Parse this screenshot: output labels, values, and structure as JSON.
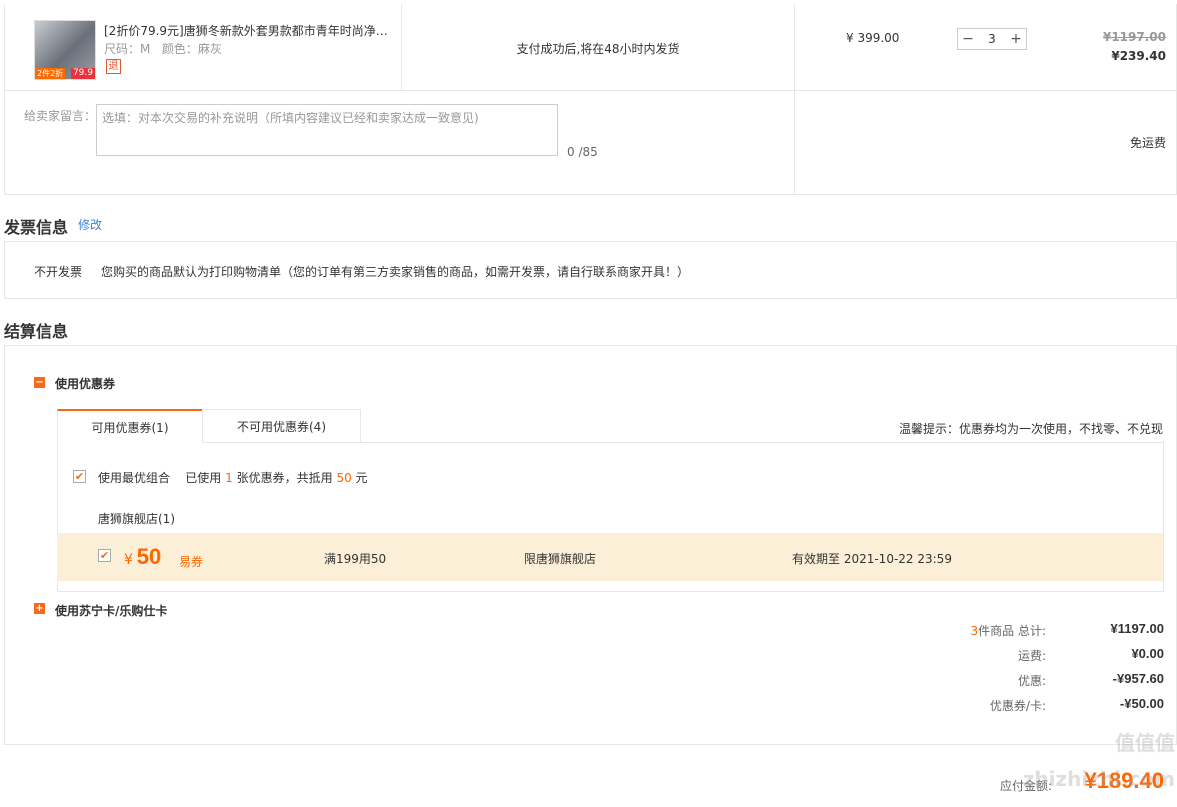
{
  "product": {
    "title": "[2折价79.9元]唐狮冬新款外套男款都市青年时尚净…",
    "size_label": "尺码：",
    "size_value": "M",
    "color_label": "颜色：",
    "color_value": "麻灰",
    "return_badge": "退",
    "thumb_tag": "2件2折",
    "thumb_price": "79.9",
    "shipping_note": "支付成功后,将在48小时内发货",
    "unit_price": "¥ 399.00",
    "quantity": "3",
    "original_total": "¥1197.00",
    "total": "¥239.40"
  },
  "remark": {
    "label": "给卖家留言：",
    "placeholder": "选填：对本次交易的补充说明（所填内容建议已经和卖家达成一致意见)",
    "counter": "0 /85",
    "freight": "免运费"
  },
  "invoice": {
    "title": "发票信息",
    "edit": "修改",
    "type": "不开发票",
    "note": "您购买的商品默认为打印购物清单（您的订单有第三方卖家销售的商品，如需开发票，请自行联系商家开具！）"
  },
  "settlement": {
    "title": "结算信息",
    "use_coupon": "使用优惠券",
    "tabs": [
      "可用优惠券(1)",
      "不可用优惠券(4)"
    ],
    "tip": "温馨提示：优惠券均为一次使用，不找零、不兑现",
    "best_combo": "使用最优组合",
    "used_prefix": "已使用",
    "used_count": "1",
    "used_mid": "张优惠券，共抵用",
    "used_amount": "50",
    "used_suffix": "元",
    "store_group": "唐狮旗舰店(1)",
    "coupon": {
      "currency": "¥",
      "amount": "50",
      "type": "易券",
      "condition": "满199用50",
      "scope": "限唐狮旗舰店",
      "expiry": "有效期至 2021-10-22 23:59"
    },
    "use_card": "使用苏宁卡/乐购仕卡"
  },
  "summary": {
    "count": "3",
    "count_label": "件商品 总计:",
    "total": "¥1197.00",
    "freight_label": "运费:",
    "freight": "¥0.00",
    "discount_label": "优惠:",
    "discount": "-¥957.60",
    "coupon_label": "优惠券/卡:",
    "coupon": "-¥50.00",
    "payable_label": "应付金额:",
    "payable": "¥189.40"
  },
  "watermark": "值值值 zhizhizhi.com",
  "colors": {
    "accent": "#ff6600",
    "coupon_bg": "#fcefd7",
    "link": "#3a83d8"
  }
}
